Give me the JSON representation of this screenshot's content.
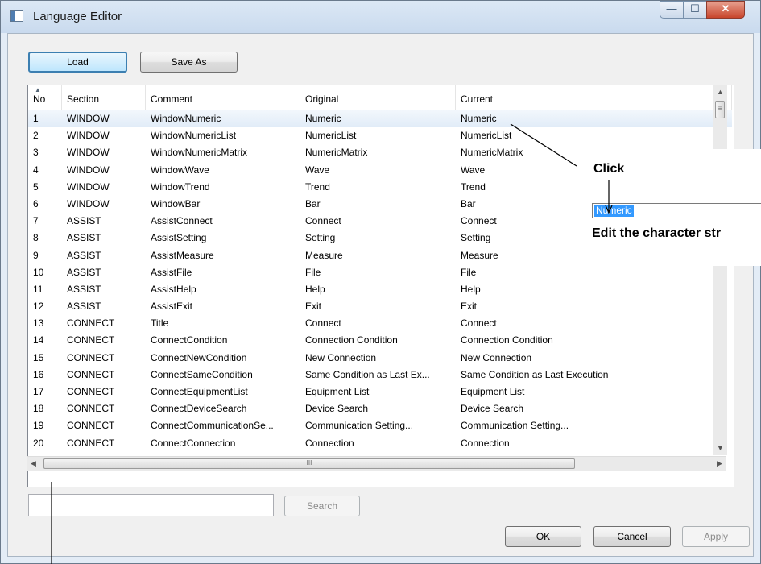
{
  "window": {
    "title": "Language Editor",
    "icon": "app-window-icon"
  },
  "window_controls": {
    "minimize": "—",
    "maximize": "☐",
    "close": "✕"
  },
  "toolbar": {
    "load_label": "Load",
    "save_as_label": "Save As"
  },
  "table": {
    "headers": [
      "No",
      "Section",
      "Comment",
      "Original",
      "Current"
    ],
    "sorted_column": "No",
    "selected_row": 1,
    "rows": [
      [
        "1",
        "WINDOW",
        "WindowNumeric",
        "Numeric",
        "Numeric"
      ],
      [
        "2",
        "WINDOW",
        "WindowNumericList",
        "NumericList",
        "NumericList"
      ],
      [
        "3",
        "WINDOW",
        "WindowNumericMatrix",
        "NumericMatrix",
        "NumericMatrix"
      ],
      [
        "4",
        "WINDOW",
        "WindowWave",
        "Wave",
        "Wave"
      ],
      [
        "5",
        "WINDOW",
        "WindowTrend",
        "Trend",
        "Trend"
      ],
      [
        "6",
        "WINDOW",
        "WindowBar",
        "Bar",
        "Bar"
      ],
      [
        "7",
        "ASSIST",
        "AssistConnect",
        "Connect",
        "Connect"
      ],
      [
        "8",
        "ASSIST",
        "AssistSetting",
        "Setting",
        "Setting"
      ],
      [
        "9",
        "ASSIST",
        "AssistMeasure",
        "Measure",
        "Measure"
      ],
      [
        "10",
        "ASSIST",
        "AssistFile",
        "File",
        "File"
      ],
      [
        "11",
        "ASSIST",
        "AssistHelp",
        "Help",
        "Help"
      ],
      [
        "12",
        "ASSIST",
        "AssistExit",
        "Exit",
        "Exit"
      ],
      [
        "13",
        "CONNECT",
        "Title",
        "Connect",
        "Connect"
      ],
      [
        "14",
        "CONNECT",
        "ConnectCondition",
        "Connection Condition",
        "Connection Condition"
      ],
      [
        "15",
        "CONNECT",
        "ConnectNewCondition",
        "New Connection",
        "New Connection"
      ],
      [
        "16",
        "CONNECT",
        "ConnectSameCondition",
        "Same Condition as Last Ex...",
        "Same Condition as Last Execution"
      ],
      [
        "17",
        "CONNECT",
        "ConnectEquipmentList",
        "Equipment List",
        "Equipment List"
      ],
      [
        "18",
        "CONNECT",
        "ConnectDeviceSearch",
        "Device Search",
        "Device Search"
      ],
      [
        "19",
        "CONNECT",
        "ConnectCommunicationSe...",
        "Communication Setting...",
        "Communication Setting..."
      ],
      [
        "20",
        "CONNECT",
        "ConnectConnection",
        "Connection",
        "Connection"
      ]
    ]
  },
  "scrollbars": {
    "h_thumb_grip": "III",
    "v_thumb_grip": "≡"
  },
  "search": {
    "value": "",
    "button_label": "Search"
  },
  "footer": {
    "ok_label": "OK",
    "cancel_label": "Cancel",
    "apply_label": "Apply"
  },
  "annotation": {
    "click_label": "Click",
    "edit_field_value": "Numeric",
    "edit_caption": "Edit the character str"
  }
}
